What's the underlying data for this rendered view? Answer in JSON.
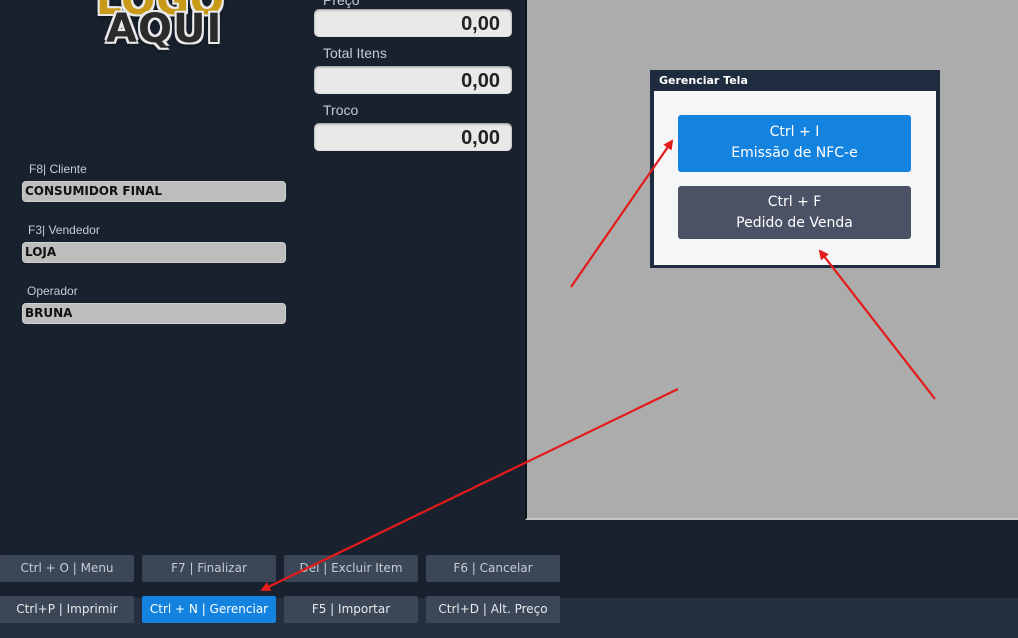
{
  "logo": {
    "line1": "LOGO",
    "line2": "AQUI"
  },
  "totals": {
    "preco": {
      "label": "Preço",
      "value": "0,00"
    },
    "total_itens": {
      "label": "Total Itens",
      "value": "0,00"
    },
    "troco": {
      "label": "Troco",
      "value": "0,00"
    }
  },
  "fields": {
    "cliente": {
      "label": "F8| Cliente",
      "value": "CONSUMIDOR FINAL"
    },
    "vendedor": {
      "label": "F3| Vendedor",
      "value": "LOJA"
    },
    "operador": {
      "label": "Operador",
      "value": "BRUNA"
    }
  },
  "dialog": {
    "title": "Gerenciar Tela",
    "nfce": {
      "shortcut": "Ctrl + I",
      "label": "Emissão de NFC-e"
    },
    "pedido": {
      "shortcut": "Ctrl + F",
      "label": "Pedido de Venda"
    }
  },
  "bottom_bar": {
    "row1": [
      "Ctrl + O | Menu",
      "F7 | Finalizar",
      "Del | Excluir Item",
      "F6 | Cancelar"
    ],
    "row2": [
      "Ctrl+P | Imprimir",
      "Ctrl + N | Gerenciar",
      "F5 | Importar",
      "Ctrl+D | Alt. Preço"
    ]
  },
  "colors": {
    "background": "#18212d",
    "accent": "#1483e0",
    "arrow": "#e41b1b",
    "panel": "#acacac"
  }
}
